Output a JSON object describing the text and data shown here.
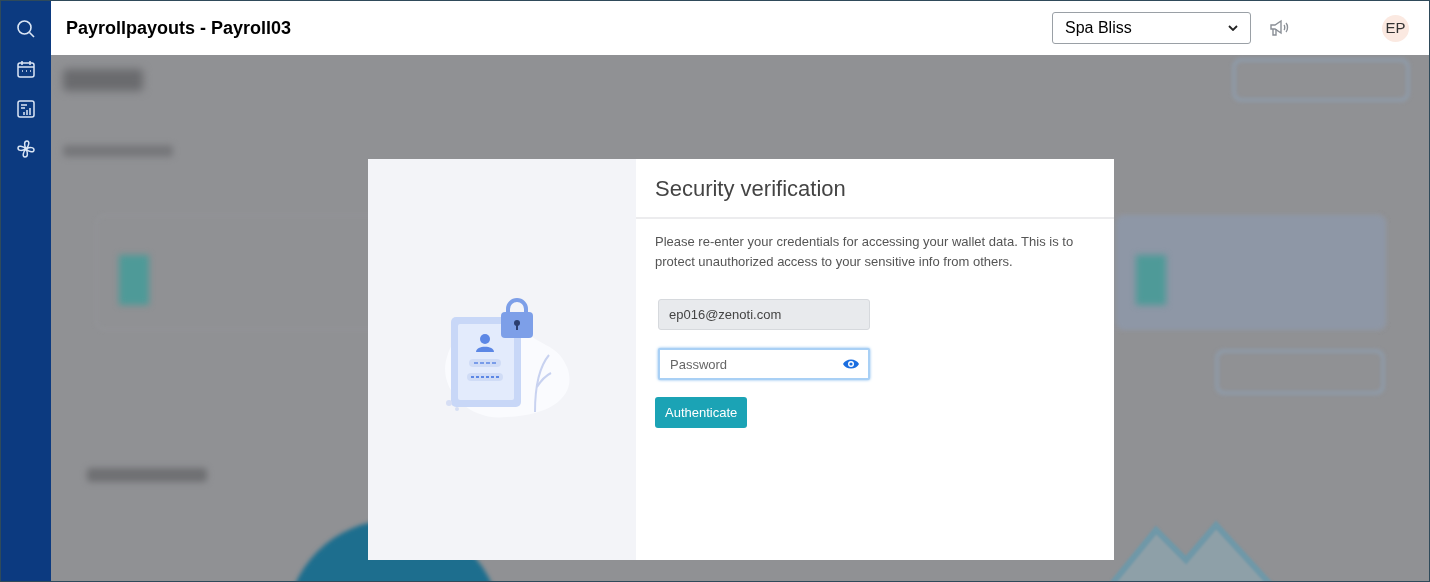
{
  "header": {
    "title": "Payrollpayouts - Payroll03",
    "location_select": {
      "value": "Spa Bliss"
    },
    "avatar": {
      "initials": "EP"
    }
  },
  "dialog": {
    "title": "Security verification",
    "message": "Please re-enter your credentials for accessing your wallet data. This is to protect unauthorized access to your sensitive info from others.",
    "email_field": {
      "value": "ep016@zenoti.com",
      "disabled": true
    },
    "password_field": {
      "placeholder": "Password",
      "focused": true
    },
    "authenticate_button": {
      "label": "Authenticate"
    }
  }
}
